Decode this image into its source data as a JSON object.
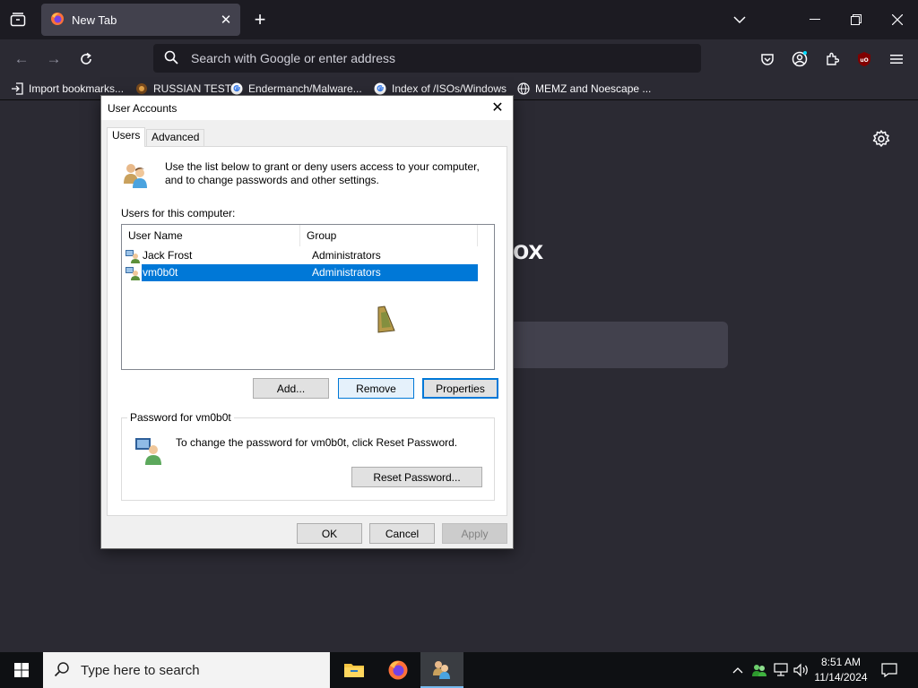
{
  "browser": {
    "tab_title": "New Tab",
    "url_placeholder": "Search with Google or enter address",
    "bookmarks": [
      {
        "label": "Import bookmarks...",
        "icon": "import-icon"
      },
      {
        "label": "RUSSIAN TEST",
        "icon": "globe-icon"
      },
      {
        "label": "Endermanch/Malware...",
        "icon": "google-icon"
      },
      {
        "label": "Index of /ISOs/Windows",
        "icon": "google-icon"
      },
      {
        "label": "MEMZ and Noescape ...",
        "icon": "globe-icon"
      }
    ],
    "page_fragment": "ox"
  },
  "dialog": {
    "title": "User Accounts",
    "tabs": [
      "Users",
      "Advanced"
    ],
    "intro": "Use the list below to grant or deny users access to your computer, and to change passwords and other settings.",
    "users_label": "Users for this computer:",
    "columns": [
      "User Name",
      "Group"
    ],
    "users": [
      {
        "name": "Jack Frost",
        "group": "Administrators",
        "selected": false
      },
      {
        "name": "vm0b0t",
        "group": "Administrators",
        "selected": true
      }
    ],
    "buttons": {
      "add": "Add...",
      "remove": "Remove",
      "properties": "Properties"
    },
    "password_group": {
      "legend": "Password for vm0b0t",
      "text": "To change the password for vm0b0t, click Reset Password.",
      "reset_button": "Reset Password..."
    },
    "footer": {
      "ok": "OK",
      "cancel": "Cancel",
      "apply": "Apply"
    }
  },
  "taskbar": {
    "search_placeholder": "Type here to search",
    "time": "8:51 AM",
    "date": "11/14/2024"
  },
  "colors": {
    "selection": "#0078d7",
    "browser_bg": "#2b2a33",
    "tab_active": "#42414d"
  }
}
